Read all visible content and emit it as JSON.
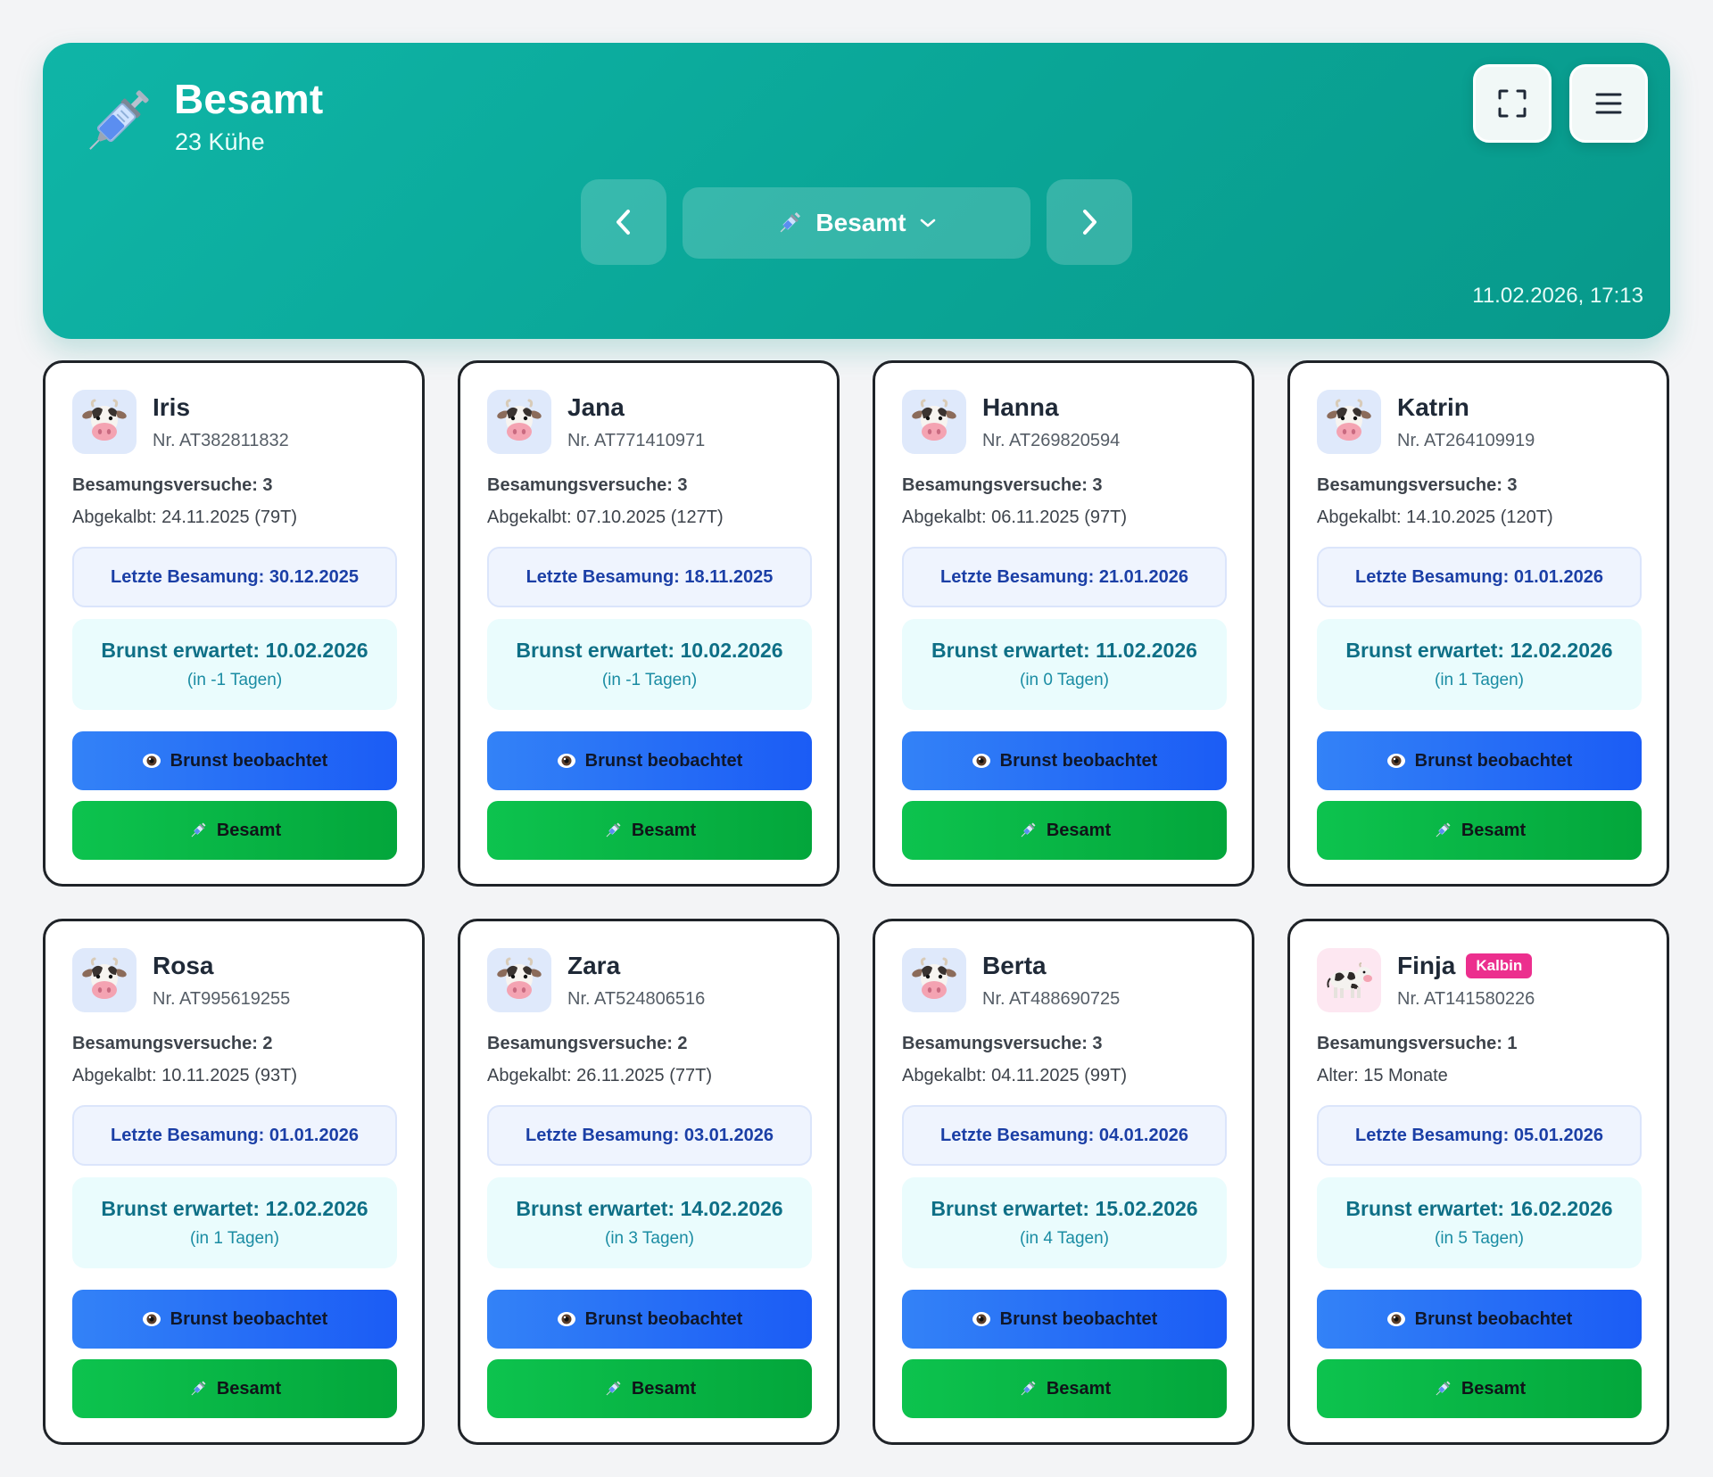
{
  "header": {
    "title": "Besamt",
    "subtitle": "23 Kühe",
    "icon": "syringe-icon",
    "status_select_label": "Besamt",
    "timestamp": "11.02.2026, 17:13"
  },
  "colors": {
    "header_teal": "#0aa596",
    "blue_button": "#1b5cf5",
    "green_button": "#03a63b",
    "badge_pink": "#ec2f8e",
    "last_insem_text": "#1b3fa6",
    "expect_text": "#0e6f86"
  },
  "buttons": {
    "heat_observed": "Brunst beobachtet",
    "inseminated": "Besamt"
  },
  "cows": [
    {
      "name": "Iris",
      "nr": "Nr. AT382811832",
      "attempts": "Besamungsversuche: 3",
      "info": "Abgekalbt: 24.11.2025 (79T)",
      "last": "Letzte Besamung: 30.12.2025",
      "expected": "Brunst erwartet: 10.02.2026",
      "days": "(in -1 Tagen)",
      "badge": "",
      "avatar": "cow-face-icon"
    },
    {
      "name": "Jana",
      "nr": "Nr. AT771410971",
      "attempts": "Besamungsversuche: 3",
      "info": "Abgekalbt: 07.10.2025 (127T)",
      "last": "Letzte Besamung: 18.11.2025",
      "expected": "Brunst erwartet: 10.02.2026",
      "days": "(in -1 Tagen)",
      "badge": "",
      "avatar": "cow-face-icon"
    },
    {
      "name": "Hanna",
      "nr": "Nr. AT269820594",
      "attempts": "Besamungsversuche: 3",
      "info": "Abgekalbt: 06.11.2025 (97T)",
      "last": "Letzte Besamung: 21.01.2026",
      "expected": "Brunst erwartet: 11.02.2026",
      "days": "(in 0 Tagen)",
      "badge": "",
      "avatar": "cow-face-icon"
    },
    {
      "name": "Katrin",
      "nr": "Nr. AT264109919",
      "attempts": "Besamungsversuche: 3",
      "info": "Abgekalbt: 14.10.2025 (120T)",
      "last": "Letzte Besamung: 01.01.2026",
      "expected": "Brunst erwartet: 12.02.2026",
      "days": "(in 1 Tagen)",
      "badge": "",
      "avatar": "cow-face-icon"
    },
    {
      "name": "Rosa",
      "nr": "Nr. AT995619255",
      "attempts": "Besamungsversuche: 2",
      "info": "Abgekalbt: 10.11.2025 (93T)",
      "last": "Letzte Besamung: 01.01.2026",
      "expected": "Brunst erwartet: 12.02.2026",
      "days": "(in 1 Tagen)",
      "badge": "",
      "avatar": "cow-face-icon"
    },
    {
      "name": "Zara",
      "nr": "Nr. AT524806516",
      "attempts": "Besamungsversuche: 2",
      "info": "Abgekalbt: 26.11.2025 (77T)",
      "last": "Letzte Besamung: 03.01.2026",
      "expected": "Brunst erwartet: 14.02.2026",
      "days": "(in 3 Tagen)",
      "badge": "",
      "avatar": "cow-face-icon"
    },
    {
      "name": "Berta",
      "nr": "Nr. AT488690725",
      "attempts": "Besamungsversuche: 3",
      "info": "Abgekalbt: 04.11.2025 (99T)",
      "last": "Letzte Besamung: 04.01.2026",
      "expected": "Brunst erwartet: 15.02.2026",
      "days": "(in 4 Tagen)",
      "badge": "",
      "avatar": "cow-face-icon"
    },
    {
      "name": "Finja",
      "nr": "Nr. AT141580226",
      "attempts": "Besamungsversuche: 1",
      "info": "Alter: 15 Monate",
      "last": "Letzte Besamung: 05.01.2026",
      "expected": "Brunst erwartet: 16.02.2026",
      "days": "(in 5 Tagen)",
      "badge": "Kalbin",
      "avatar": "cow-icon"
    }
  ]
}
